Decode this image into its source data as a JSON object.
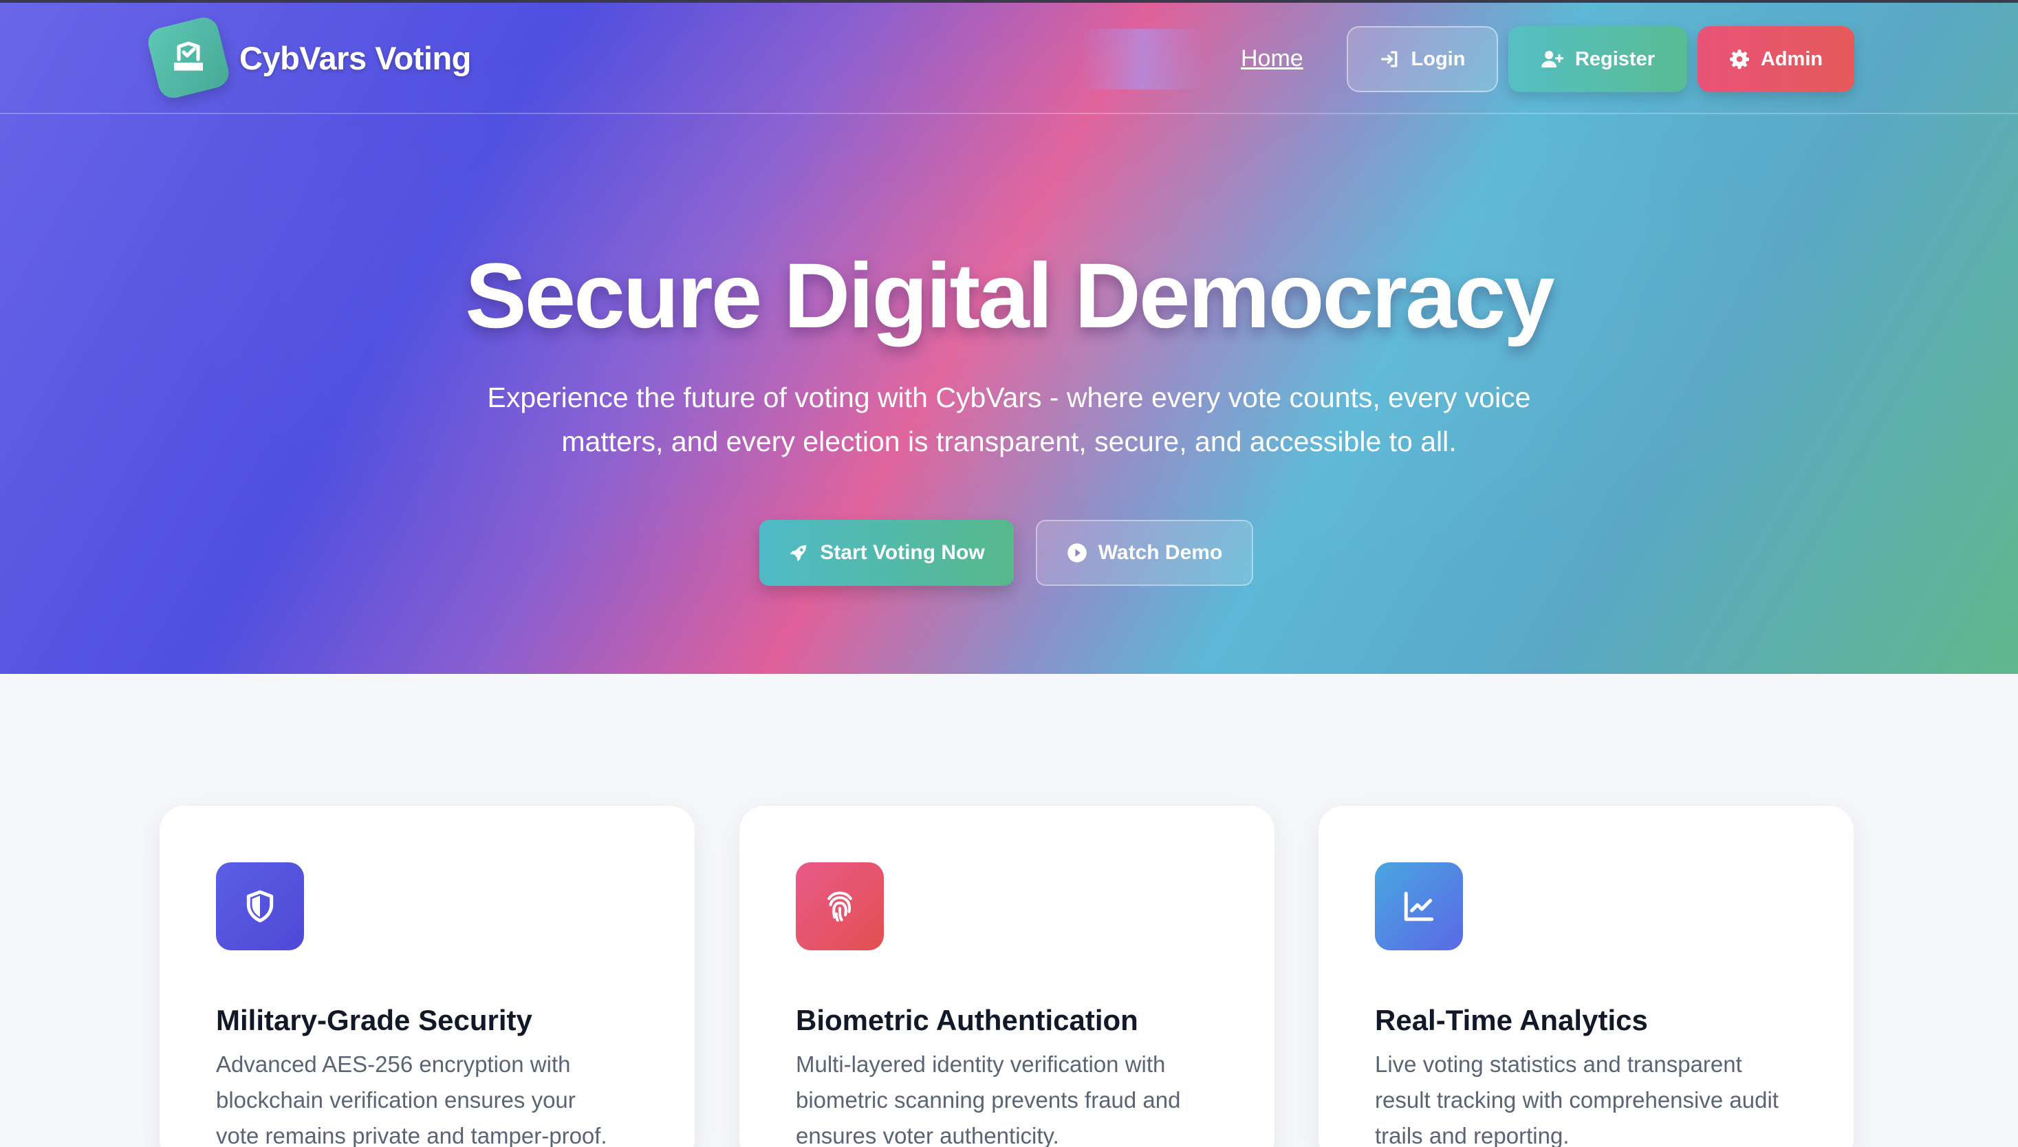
{
  "brand": {
    "name": "CybVars Voting",
    "logo_icon": "vote-box-icon"
  },
  "nav": {
    "home": "Home",
    "login": "Login",
    "register": "Register",
    "admin": "Admin"
  },
  "hero": {
    "title": "Secure Digital Democracy",
    "subtitle_line1": "Experience the future of voting with CybVars - where every vote counts, every voice",
    "subtitle_line2": "matters, and every election is transparent, secure, and accessible to all.",
    "cta_primary": "Start Voting Now",
    "cta_secondary": "Watch Demo"
  },
  "features": [
    {
      "icon": "shield-icon",
      "title": "Military-Grade Security",
      "line1": "Advanced AES-256 encryption with",
      "line2": "blockchain verification ensures your",
      "line3": "vote remains private and tamper-proof."
    },
    {
      "icon": "fingerprint-icon",
      "title": "Biometric Authentication",
      "line1": "Multi-layered identity verification with",
      "line2": "biometric scanning prevents fraud and",
      "line3": "ensures voter authenticity."
    },
    {
      "icon": "chart-line-icon",
      "title": "Real-Time Analytics",
      "line1": "Live voting statistics and transparent",
      "line2": "result tracking with comprehensive audit",
      "line3": "trails and reporting."
    }
  ],
  "colors": {
    "accent_teal": "#56bfc4",
    "accent_red": "#e85478",
    "accent_indigo": "#4f4fe0"
  }
}
